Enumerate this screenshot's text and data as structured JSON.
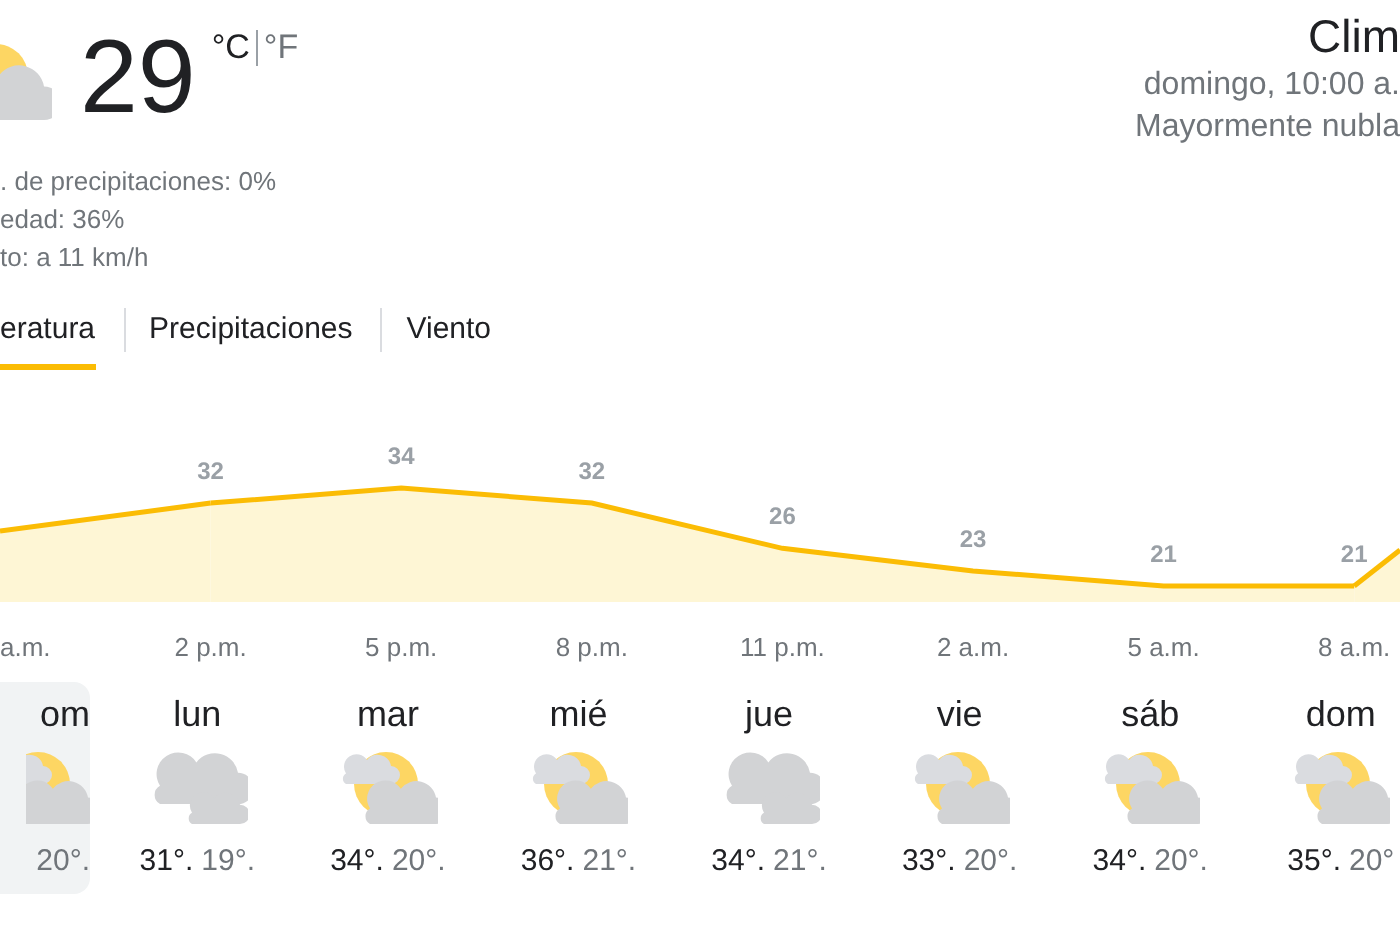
{
  "current": {
    "temperature": "29",
    "units": [
      {
        "label": "°C",
        "selected": true
      },
      {
        "label": "°F",
        "selected": false
      }
    ],
    "details": [
      ". de precipitaciones: 0%",
      "edad: 36%",
      "to: a 11 km/h"
    ]
  },
  "location": {
    "title": "Clim",
    "time": "domingo, 10:00 a.",
    "condition": "Mayormente nubla"
  },
  "tabs": [
    {
      "label": "eratura",
      "selected": true
    },
    {
      "label": "Precipitaciones",
      "selected": false
    },
    {
      "label": "Viento",
      "selected": false
    }
  ],
  "chart": {
    "chart_data": {
      "type": "area",
      "categories": [
        "a.m.",
        "2 p.m.",
        "5 p.m.",
        "8 p.m.",
        "11 p.m.",
        "2 a.m.",
        "5 a.m.",
        "8 a.m."
      ],
      "values": [
        null,
        32,
        34,
        32,
        26,
        23,
        21,
        21
      ],
      "data_labels": true
    }
  },
  "days": [
    {
      "day": "om",
      "kind": "partly_cloudy",
      "selected": true,
      "low": "20°."
    },
    {
      "day": "lun",
      "kind": "cloudy",
      "selected": false,
      "high": "31°.",
      "low": "19°."
    },
    {
      "day": "mar",
      "kind": "partly_cloudy",
      "selected": false,
      "high": "34°.",
      "low": "20°."
    },
    {
      "day": "mié",
      "kind": "partly_cloudy",
      "selected": false,
      "high": "36°.",
      "low": "21°."
    },
    {
      "day": "jue",
      "kind": "cloudy",
      "selected": false,
      "high": "34°.",
      "low": "21°."
    },
    {
      "day": "vie",
      "kind": "partly_cloudy",
      "selected": false,
      "high": "33°.",
      "low": "20°."
    },
    {
      "day": "sáb",
      "kind": "partly_cloudy",
      "selected": false,
      "high": "34°.",
      "low": "20°."
    },
    {
      "day": "dom",
      "kind": "partly_cloudy",
      "selected": false,
      "high": "35°.",
      "low": "20°"
    }
  ]
}
